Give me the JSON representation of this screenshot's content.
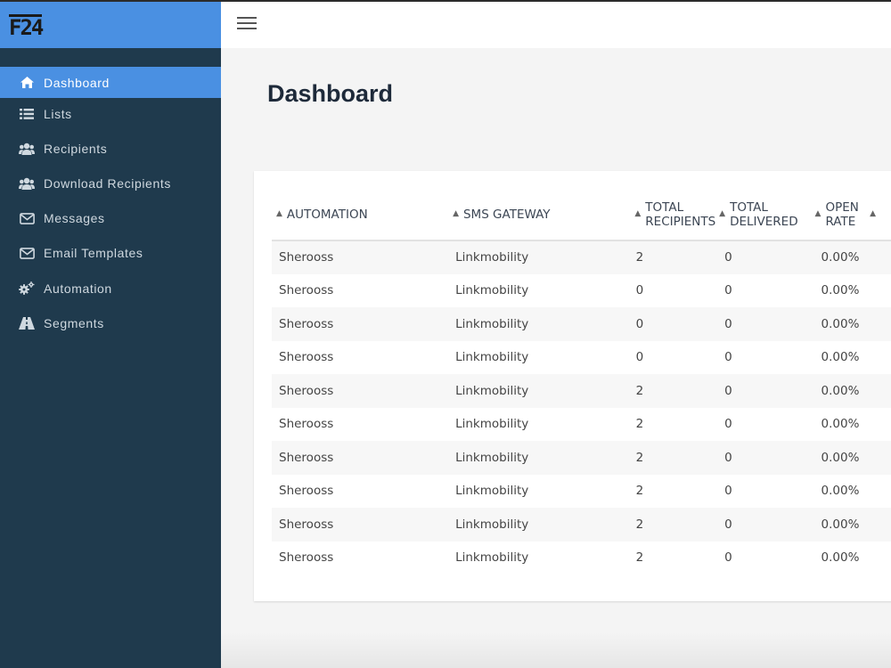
{
  "brand": {
    "logo": "F24"
  },
  "sidebar": {
    "items": [
      {
        "label": "Dashboard",
        "icon": "home-icon",
        "active": true
      },
      {
        "label": "Lists",
        "icon": "list-icon",
        "active": false
      },
      {
        "label": "Recipients",
        "icon": "users-icon",
        "active": false
      },
      {
        "label": "Download Recipients",
        "icon": "users-icon",
        "active": false
      },
      {
        "label": "Messages",
        "icon": "envelope-icon",
        "active": false
      },
      {
        "label": "Email Templates",
        "icon": "envelope-icon",
        "active": false
      },
      {
        "label": "Automation",
        "icon": "gears-icon",
        "active": false
      },
      {
        "label": "Segments",
        "icon": "road-icon",
        "active": false
      }
    ]
  },
  "page": {
    "title": "Dashboard"
  },
  "table": {
    "headers": {
      "automation": "AUTOMATION",
      "sms_gateway": "SMS GATEWAY",
      "total_recipients_1": "TOTAL",
      "total_recipients_2": "RECIPIENTS",
      "total_delivered_1": "TOTAL",
      "total_delivered_2": "DELIVERED",
      "open_rate_1": "OPEN",
      "open_rate_2": "RATE"
    },
    "rows": [
      {
        "automation": "Sherooss",
        "gateway": "Linkmobility",
        "recipients": "2",
        "delivered": "0",
        "open_rate": "0.00%"
      },
      {
        "automation": "Sherooss",
        "gateway": "Linkmobility",
        "recipients": "0",
        "delivered": "0",
        "open_rate": "0.00%"
      },
      {
        "automation": "Sherooss",
        "gateway": "Linkmobility",
        "recipients": "0",
        "delivered": "0",
        "open_rate": "0.00%"
      },
      {
        "automation": "Sherooss",
        "gateway": "Linkmobility",
        "recipients": "0",
        "delivered": "0",
        "open_rate": "0.00%"
      },
      {
        "automation": "Sherooss",
        "gateway": "Linkmobility",
        "recipients": "2",
        "delivered": "0",
        "open_rate": "0.00%"
      },
      {
        "automation": "Sherooss",
        "gateway": "Linkmobility",
        "recipients": "2",
        "delivered": "0",
        "open_rate": "0.00%"
      },
      {
        "automation": "Sherooss",
        "gateway": "Linkmobility",
        "recipients": "2",
        "delivered": "0",
        "open_rate": "0.00%"
      },
      {
        "automation": "Sherooss",
        "gateway": "Linkmobility",
        "recipients": "2",
        "delivered": "0",
        "open_rate": "0.00%"
      },
      {
        "automation": "Sherooss",
        "gateway": "Linkmobility",
        "recipients": "2",
        "delivered": "0",
        "open_rate": "0.00%"
      },
      {
        "automation": "Sherooss",
        "gateway": "Linkmobility",
        "recipients": "2",
        "delivered": "0",
        "open_rate": "0.00%"
      }
    ]
  },
  "colors": {
    "sidebar_bg": "#1f3a4d",
    "accent": "#4a90e2",
    "page_bg": "#f4f4f4"
  }
}
